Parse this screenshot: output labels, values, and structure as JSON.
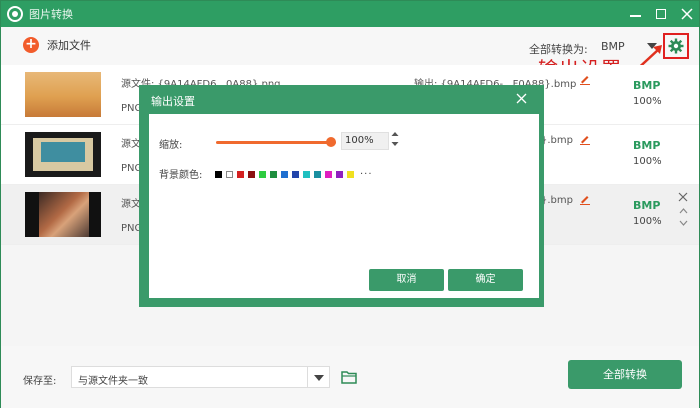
{
  "window": {
    "title": "图片转换"
  },
  "toolbar": {
    "add_files_label": "添加文件",
    "convert_all_to_label": "全部转换为:",
    "convert_all_format": "BMP"
  },
  "annotation": {
    "callout_text": "输出设置"
  },
  "files": [
    {
      "source": "源文件: {9A14AFD6...0A88}.png",
      "format": "PNG",
      "output": "输出: {9A14AFD6-...F0A88}.bmp",
      "out_format": "BMP",
      "quality": "100%"
    },
    {
      "source": "源文",
      "format": "PNG",
      "output": "}.bmp",
      "out_format": "BMP",
      "quality": "100%"
    },
    {
      "source": "源文",
      "format": "PNG",
      "output": "}.bmp",
      "out_format": "BMP",
      "quality": "100%"
    }
  ],
  "footer": {
    "save_to_label": "保存至:",
    "save_to_value": "与源文件夹一致",
    "convert_all_button": "全部转换"
  },
  "dialog": {
    "title": "输出设置",
    "zoom_label": "缩放:",
    "zoom_value": "100%",
    "zoom_level": 1.0,
    "bg_color_label": "背景颜色:",
    "swatch_colors": [
      "#000000",
      "#ffffff",
      "#d42020",
      "#8b1010",
      "#2ecc40",
      "#1e8e3e",
      "#1f6fd0",
      "#2244aa",
      "#20c0c0",
      "#1a8fa0",
      "#e020c0",
      "#9020c0",
      "#f0e020"
    ],
    "more_colors": "···",
    "cancel_button": "取消",
    "ok_button": "确定"
  }
}
